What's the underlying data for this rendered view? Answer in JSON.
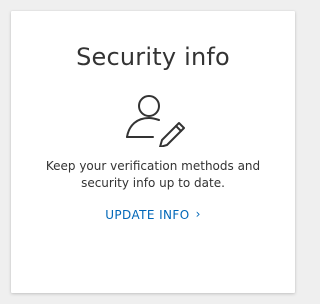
{
  "card": {
    "title": "Security info",
    "icon": "user-edit-icon",
    "description": "Keep your verification methods and security info up to date.",
    "link_label": "UPDATE INFO",
    "chevron": "›"
  },
  "colors": {
    "background": "#efefef",
    "card": "#ffffff",
    "text": "#333333",
    "link": "#0067b8"
  }
}
